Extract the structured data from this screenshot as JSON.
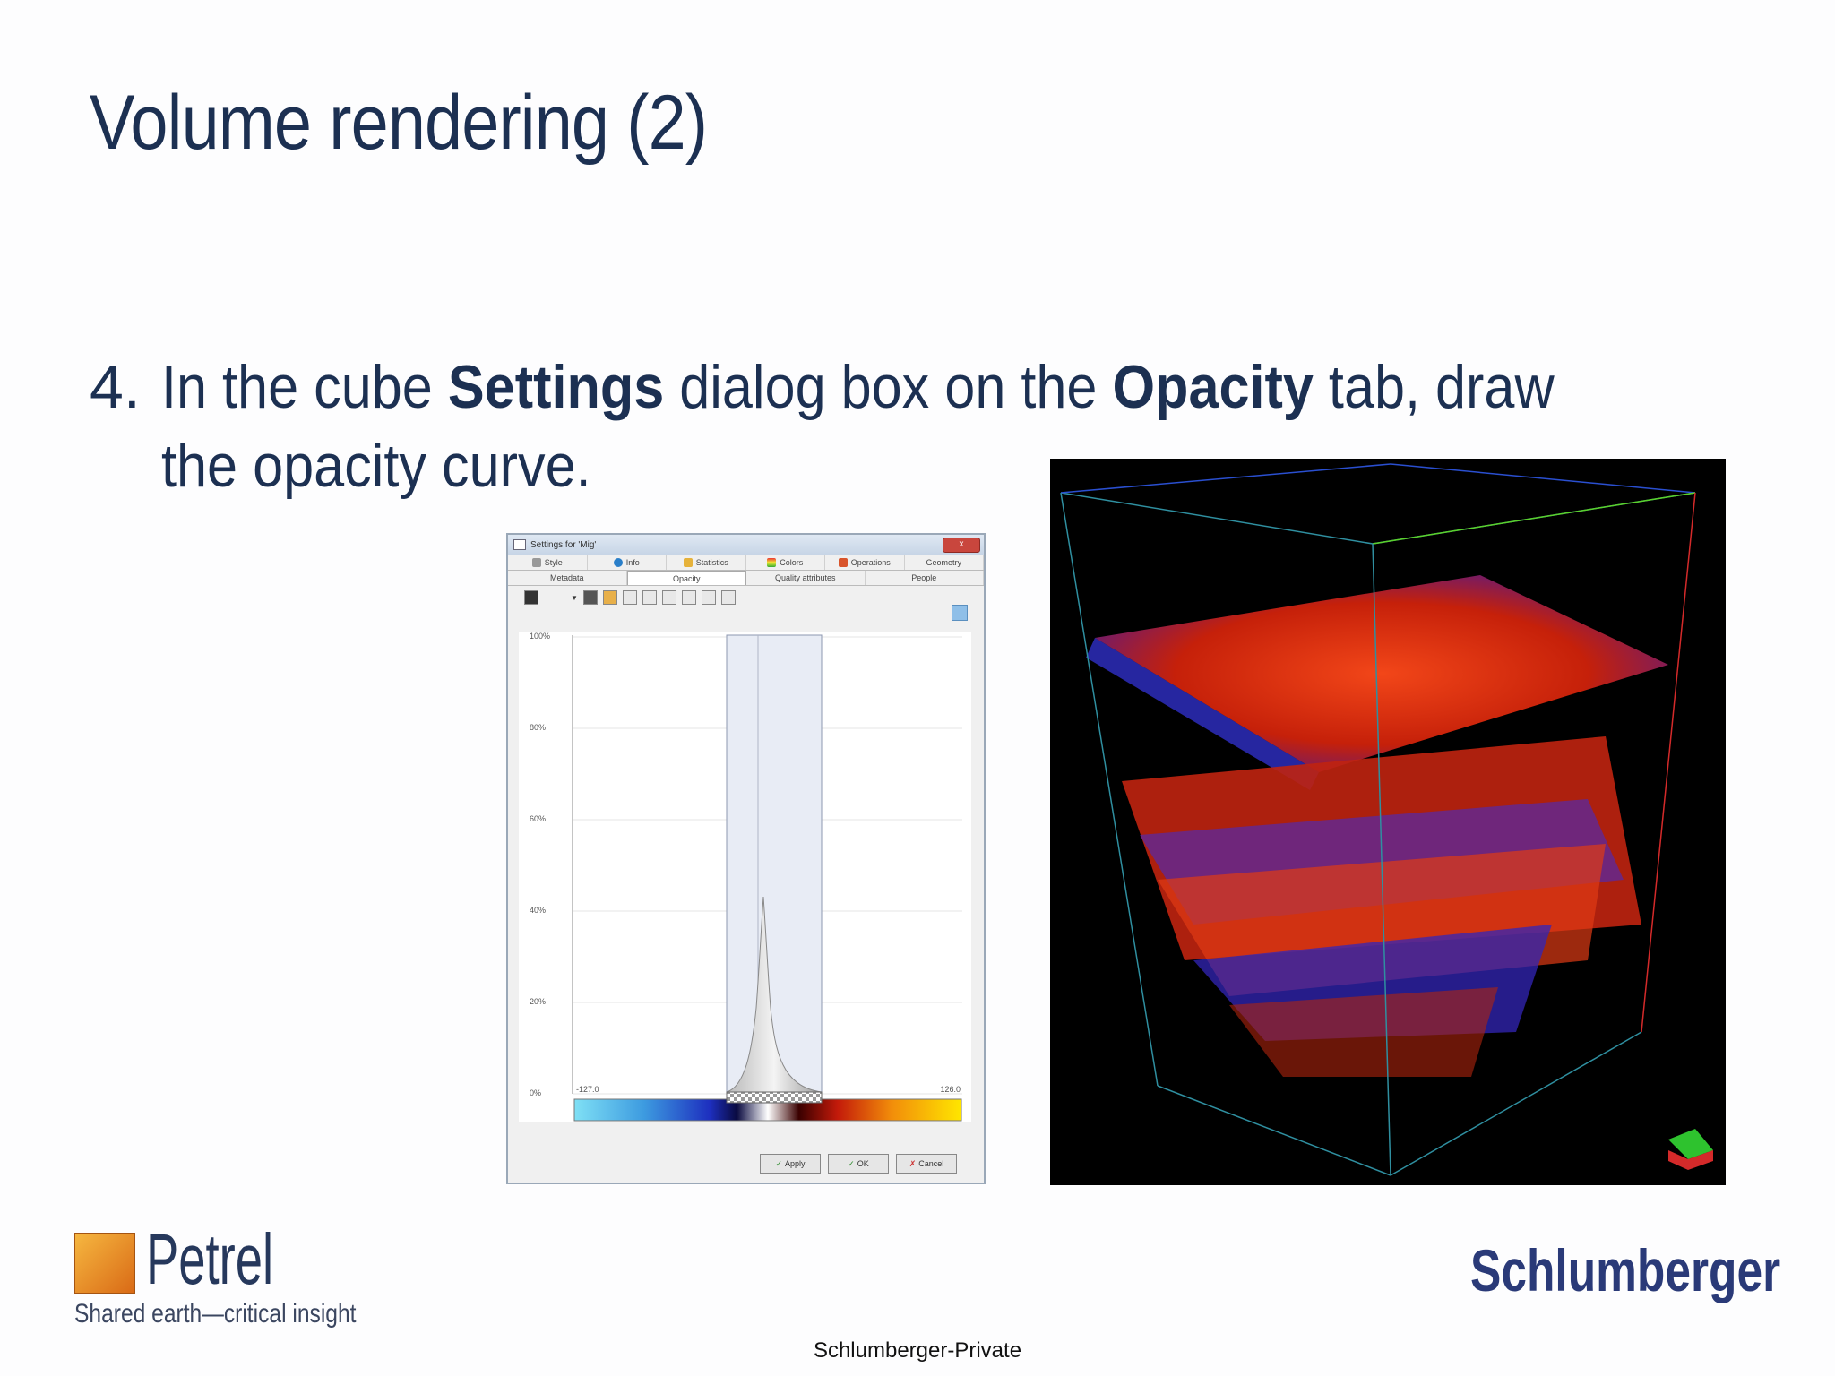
{
  "slide": {
    "title": "Volume rendering (2)",
    "bullet_number": "4.",
    "bullet_part1": "In the cube ",
    "bullet_bold1": "Settings",
    "bullet_part2": " dialog box on the ",
    "bullet_bold2": "Opacity",
    "bullet_part3": " tab, draw the opacity curve.",
    "footer": "Schlumberger-Private"
  },
  "dialog": {
    "title": "Settings for 'Mig'",
    "close_label": "x",
    "tabs_row1": [
      "Style",
      "Info",
      "Statistics",
      "Colors",
      "Operations",
      "Geometry"
    ],
    "tabs_row2": [
      "Metadata",
      "Opacity",
      "Quality attributes",
      "People"
    ],
    "active_tab": "Opacity",
    "y_axis_ticks": [
      "100%",
      "80%",
      "60%",
      "40%",
      "20%",
      "0%"
    ],
    "range_min": "-127.0",
    "range_max": "126.0",
    "buttons": {
      "apply": "Apply",
      "ok": "OK",
      "cancel": "Cancel"
    }
  },
  "logos": {
    "petrel_word": "Petrel",
    "petrel_tagline": "Shared earth—critical insight",
    "schlumberger": "Schlumberger"
  },
  "colors": {
    "title_text": "#1c3052",
    "colorbar": [
      "#7fe0f5",
      "#1d2fbf",
      "#0a0a40",
      "#ffffff",
      "#3a0000",
      "#c31a0a",
      "#f28d0a",
      "#ffe600"
    ]
  }
}
